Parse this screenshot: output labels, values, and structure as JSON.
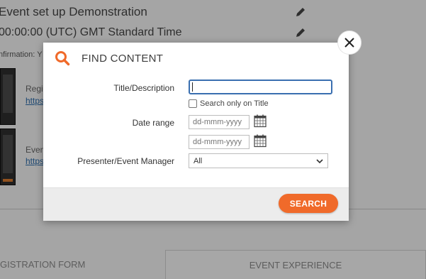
{
  "background": {
    "event_title": "Event set up Demonstration",
    "timezone": "00:00:00 (UTC) GMT Standard Time",
    "confirmation_label": "nfirmation: Y",
    "items": [
      {
        "label": "Regi",
        "link": "https"
      },
      {
        "label": "Even",
        "link": "https"
      }
    ],
    "tabs": [
      {
        "label": "GISTRATION FORM"
      },
      {
        "label": "EVENT EXPERIENCE"
      }
    ],
    "icons": {
      "edit": "pencil-icon"
    }
  },
  "modal": {
    "title": "FIND CONTENT",
    "header_icon": "search-icon",
    "close_icon": "close-icon",
    "fields": {
      "title_label": "Title/Description",
      "title_value": "",
      "title_only_label": "Search only on Title",
      "title_only_checked": false,
      "date_label": "Date range",
      "date_from_placeholder": "dd-mmm-yyyy",
      "date_to_placeholder": "dd-mmm-yyyy",
      "presenter_label": "Presenter/Event Manager",
      "presenter_selected": "All"
    },
    "search_button": "SEARCH"
  },
  "colors": {
    "accent": "#f06a2a",
    "focus_border": "#3a6fb0"
  }
}
